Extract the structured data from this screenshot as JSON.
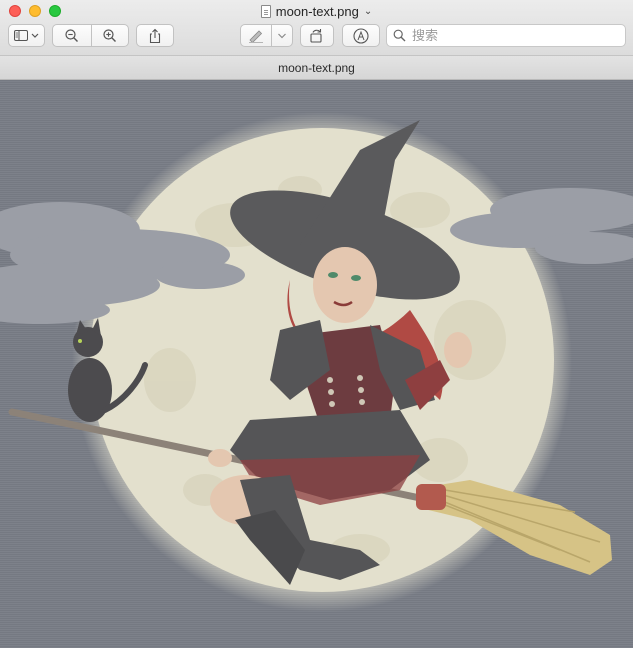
{
  "window": {
    "title": "moon-text.png",
    "title_menu": "⌄"
  },
  "toolbar": {
    "search_placeholder": "搜索"
  },
  "tab": {
    "label": "moon-text.png"
  },
  "colors": {
    "moon": "#e3e0cd",
    "sky": "#7b7f88",
    "clouds": "#9a9da4",
    "hair": "#b04a44",
    "dress": "#555557",
    "broom_straw": "#d6c386"
  }
}
